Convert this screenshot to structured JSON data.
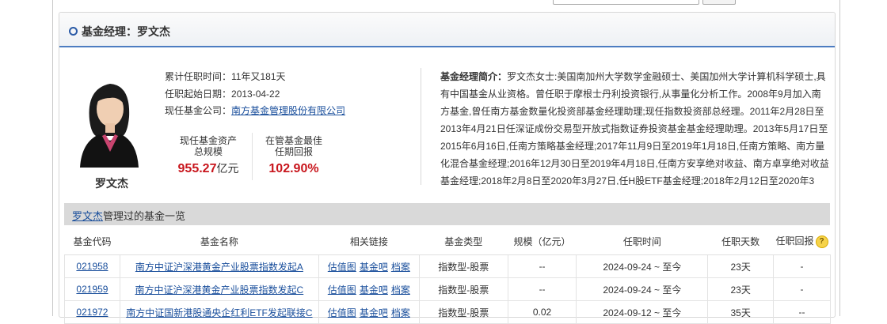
{
  "panel": {
    "title": "基金经理：罗文杰"
  },
  "manager": {
    "name": "罗文杰",
    "tenure_label": "累计任职时间：",
    "tenure_value": "11年又181天",
    "start_label": "任职起始日期：",
    "start_value": "2013-04-22",
    "company_label": "现任基金公司：",
    "company_value": "南方基金管理股份有限公司",
    "stats": [
      {
        "label_line1": "现任基金资产",
        "label_line2": "总规模",
        "value": "955.27",
        "unit": "亿元"
      },
      {
        "label_line1": "在管基金最佳",
        "label_line2": "任期回报",
        "value": "102.90%",
        "unit": ""
      }
    ],
    "bio_label": "基金经理简介：",
    "bio_text": "罗文杰女士:美国南加州大学数学金融硕士、美国加州大学计算机科学硕士,具有中国基金从业资格。曾任职于摩根士丹利投资银行,从事量化分析工作。2008年9月加入南方基金,曾任南方基金数量化投资部基金经理助理;现任指数投资部总经理。2011年2月28日至2013年4月21日任深证成份交易型开放式指数证券投资基金基金经理助理。2013年5月17日至2015年6月16日,任南方策略基金经理;2017年11月9日至2019年1月18日,任南方策略、南方量化混合基金经理;2016年12月30日至2019年4月18日,任南方安享绝对收益、南方卓享绝对收益基金经理;2018年2月8日至2020年3月27日,任H股ETF基金经理;2018年2月12日至2020年3"
  },
  "fund_list": {
    "title_link": "罗文杰",
    "title_rest": "管理过的基金一览",
    "columns": [
      "基金代码",
      "基金名称",
      "相关链接",
      "基金类型",
      "规模（亿元）",
      "任职时间",
      "任职天数",
      "任职回报"
    ],
    "link_labels": [
      "估值图",
      "基金吧",
      "档案"
    ],
    "rows": [
      {
        "code": "021958",
        "name": "南方中证沪深港黄金产业股票指数发起A",
        "type": "指数型-股票",
        "size": "--",
        "period": "2024-09-24 ~ 至今",
        "days": "23天",
        "return": "-"
      },
      {
        "code": "021959",
        "name": "南方中证沪深港黄金产业股票指数发起C",
        "type": "指数型-股票",
        "size": "--",
        "period": "2024-09-24 ~ 至今",
        "days": "23天",
        "return": "-"
      },
      {
        "code": "021972",
        "name": "南方中证国新港股通央企红利ETF发起联接C",
        "type": "指数型-股票",
        "size": "0.02",
        "period": "2024-09-12 ~ 至今",
        "days": "35天",
        "return": "--"
      }
    ]
  },
  "icons": {
    "help": "question-mark-icon",
    "section": "circle-bullet-icon"
  }
}
